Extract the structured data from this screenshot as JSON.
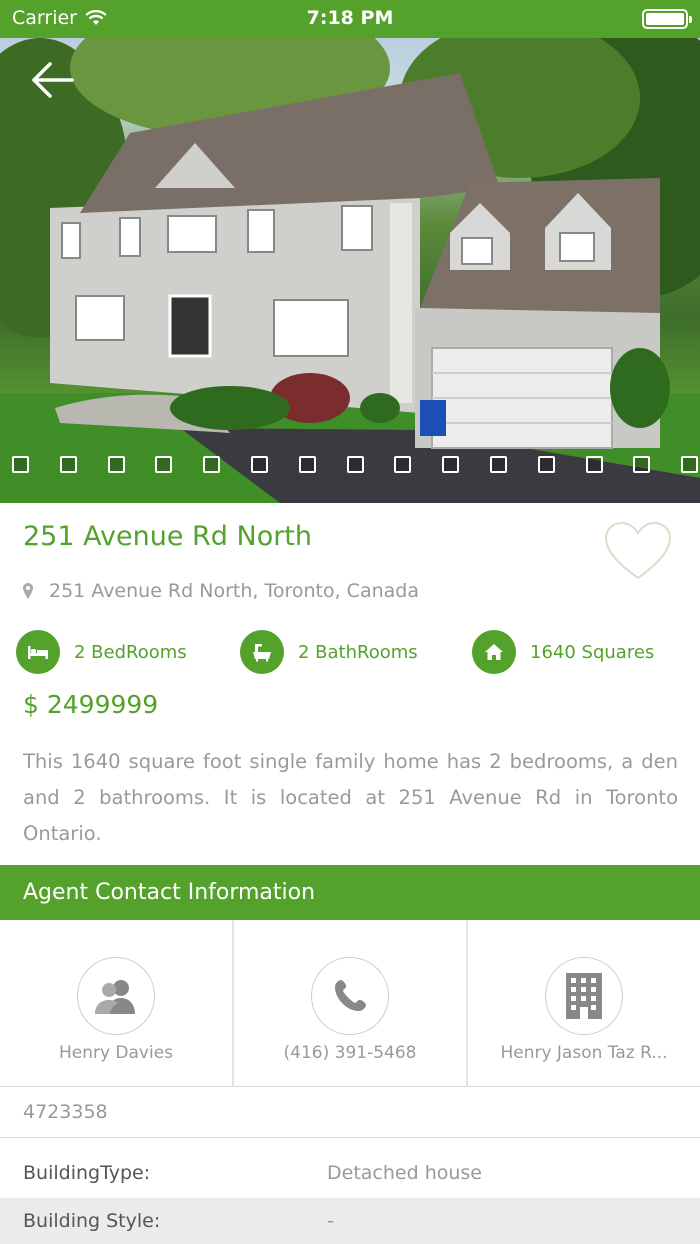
{
  "status": {
    "carrier": "Carrier",
    "time": "7:18 PM"
  },
  "gallery": {
    "count": 15
  },
  "property": {
    "title": "251 Avenue Rd North",
    "address": "251 Avenue Rd North, Toronto, Canada",
    "bedrooms": "2 BedRooms",
    "bathrooms": "2 BathRooms",
    "area": "1640 Squares",
    "price": "$ 2499999",
    "description": "This 1640 square foot single family home has 2 bedrooms, a den and 2 bathrooms. It is located at 251 Avenue Rd in Toronto Ontario."
  },
  "agent": {
    "header": "Agent Contact Information",
    "name": "Henry Davies",
    "phone": "(416) 391-5468",
    "company": "Henry Jason Taz R..."
  },
  "listing_id": "4723358",
  "details": [
    {
      "key": "BuildingType:",
      "value": "Detached house"
    },
    {
      "key": "Building Style:",
      "value": "-"
    }
  ],
  "colors": {
    "accent": "#54a12b",
    "muted_text": "#999999"
  }
}
